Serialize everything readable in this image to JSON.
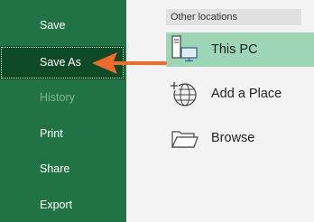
{
  "sidebar": {
    "items": [
      {
        "label": "Save",
        "state": "normal"
      },
      {
        "label": "Save As",
        "state": "selected"
      },
      {
        "label": "History",
        "state": "disabled"
      },
      {
        "label": "Print",
        "state": "normal"
      },
      {
        "label": "Share",
        "state": "normal"
      },
      {
        "label": "Export",
        "state": "normal"
      }
    ]
  },
  "main": {
    "section_title": "Other locations",
    "locations": [
      {
        "label": "This PC",
        "icon": "computer-icon",
        "selected": true
      },
      {
        "label": "Add a Place",
        "icon": "globe-add-icon",
        "selected": false
      },
      {
        "label": "Browse",
        "icon": "folder-icon",
        "selected": false
      }
    ]
  },
  "colors": {
    "sidebar_bg": "#217346",
    "sidebar_selected_bg": "#0f4a27",
    "main_bg": "#f3f3f3",
    "location_selected_bg": "#9fd5b7",
    "annotation_arrow": "#f06a2a"
  }
}
